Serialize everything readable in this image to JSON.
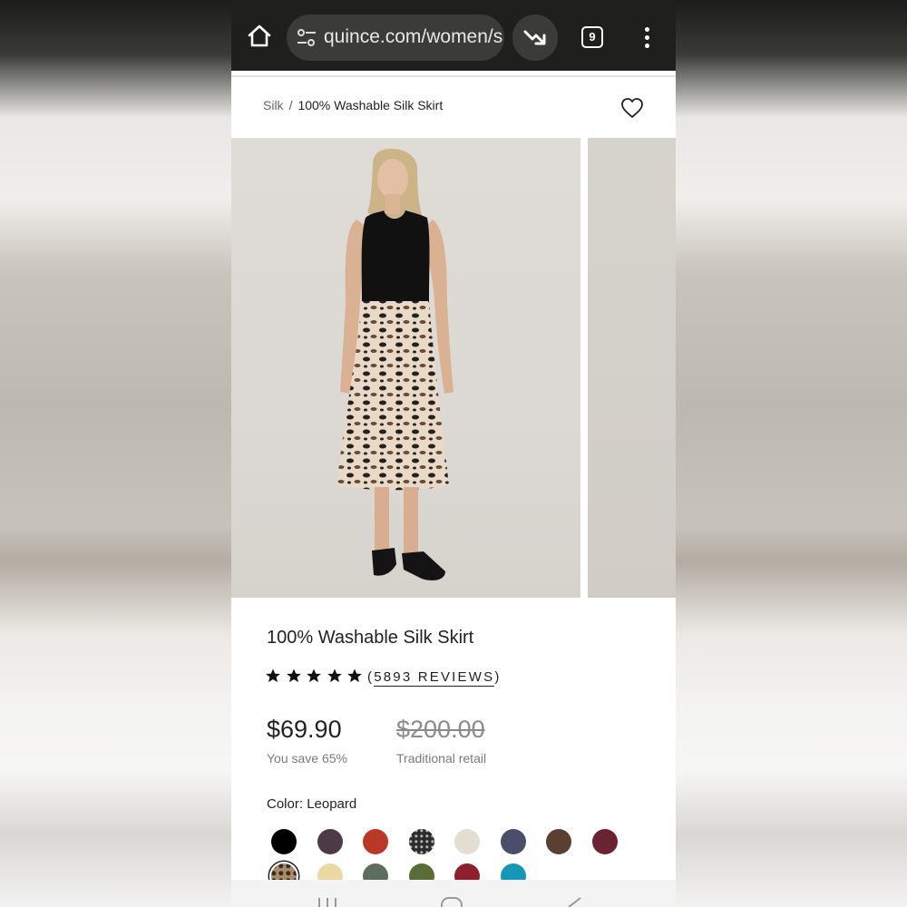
{
  "browser": {
    "url": "quince.com/women/s",
    "tab_count": "9",
    "icons": [
      "home-icon",
      "site-settings-icon",
      "trending-down-icon",
      "tabs-icon",
      "more-vert-icon"
    ]
  },
  "breadcrumb": {
    "parent": "Silk",
    "separator": "/",
    "current": "100% Washable Silk Skirt"
  },
  "product": {
    "title": "100% Washable Silk Skirt",
    "rating_stars": 5,
    "reviews_label": "5893 REVIEWS",
    "reviews_open": "(",
    "reviews_close": ")",
    "price": "$69.90",
    "original_price": "$200.00",
    "save_note": "You save 65%",
    "retail_note": "Traditional retail",
    "color_label": "Color:",
    "color_value": "Leopard"
  },
  "swatches": {
    "row1": [
      "#000000",
      "#4d3a47",
      "#b83a26",
      "#2b2b2b",
      "#e4ddd1",
      "#4a4d6b",
      "#5a3f33",
      "#6a2330"
    ],
    "row2": [
      "#a88e6c",
      "#ecd8a3",
      "#5d6e5d",
      "#5a6d35",
      "#8f1f2c",
      "#1597b8"
    ],
    "selected": "leopard"
  }
}
